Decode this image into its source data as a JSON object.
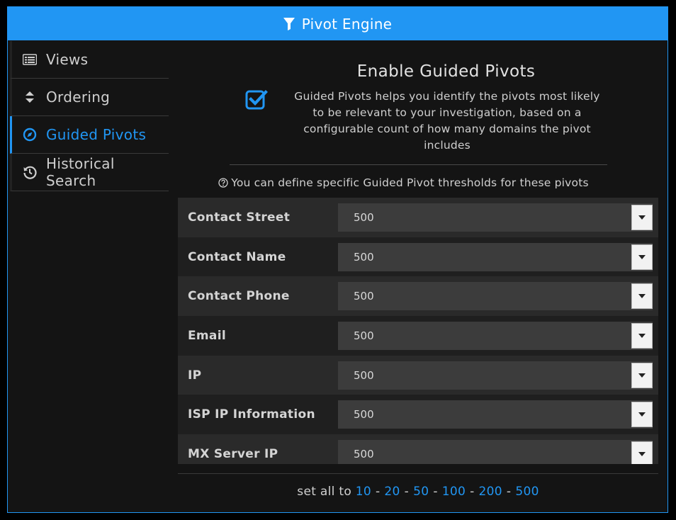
{
  "window": {
    "title": "Pivot Engine",
    "title_icon": "filter-icon",
    "accent_color": "#2196f3"
  },
  "sidebar": {
    "items": [
      {
        "label": "Views",
        "icon": "list-icon",
        "active": false
      },
      {
        "label": "Ordering",
        "icon": "sort-icon",
        "active": false
      },
      {
        "label": "Guided Pivots",
        "icon": "compass-icon",
        "active": true
      },
      {
        "label": "Historical Search",
        "icon": "history-icon",
        "active": false
      }
    ]
  },
  "main": {
    "heading": "Enable Guided Pivots",
    "enable_checked": true,
    "description": "Guided Pivots helps you identify the pivots most likely to be relevant to your investigation, based on a configurable count of how many domains the pivot includes",
    "hint": "You can define specific Guided Pivot thresholds for these pivots",
    "rows": [
      {
        "label": "Contact Street",
        "value": "500"
      },
      {
        "label": "Contact Name",
        "value": "500"
      },
      {
        "label": "Contact Phone",
        "value": "500"
      },
      {
        "label": "Email",
        "value": "500"
      },
      {
        "label": "IP",
        "value": "500"
      },
      {
        "label": "ISP IP Information",
        "value": "500"
      },
      {
        "label": "MX Server IP",
        "value": "500"
      }
    ],
    "set_all_label": "set all to",
    "set_all_options": [
      "10",
      "20",
      "50",
      "100",
      "200",
      "500"
    ]
  }
}
